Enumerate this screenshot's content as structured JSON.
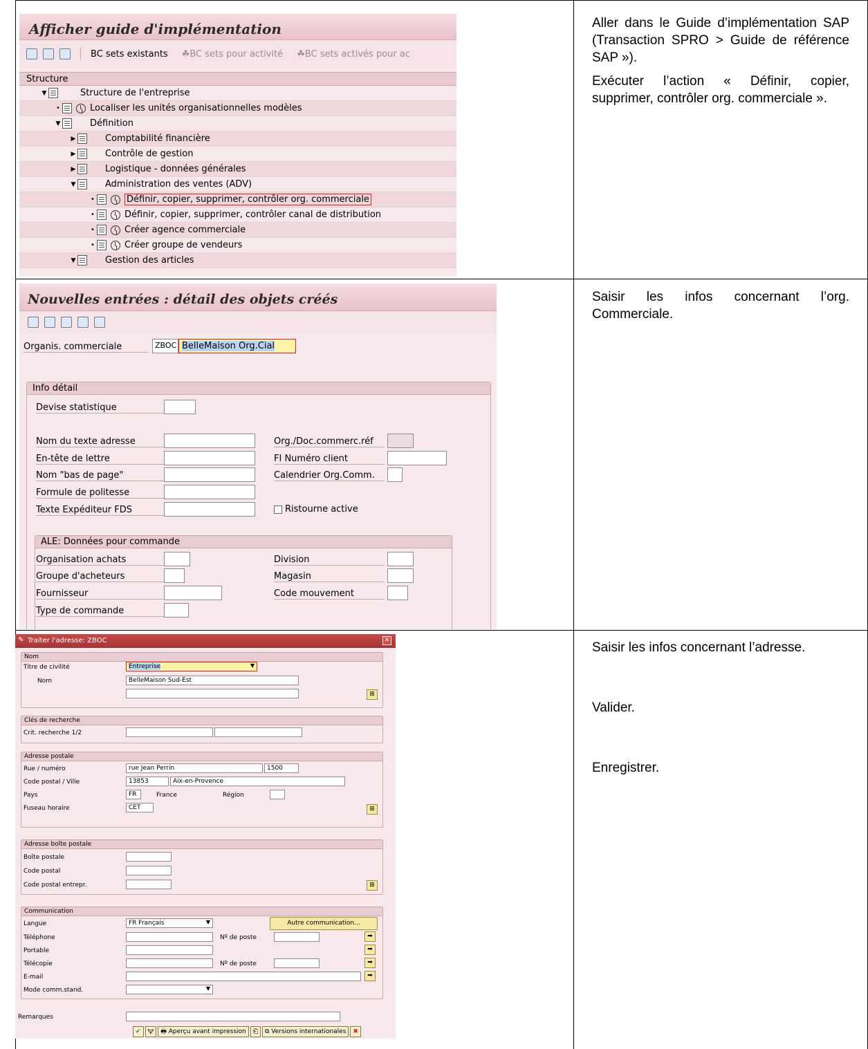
{
  "rows": [
    {
      "instructions": [
        "Aller dans le Guide d’implémentation SAP (Transaction SPRO > Guide de référence SAP »).",
        "Exécuter l’action « Définir, copier, supprimer, contrôler org. commerciale »."
      ]
    },
    {
      "instructions": [
        "Saisir les infos concernant l’org. Commerciale."
      ]
    },
    {
      "instructions": [
        "Saisir les infos concernant l’adresse.",
        "Valider.",
        "Enregistrer."
      ]
    }
  ],
  "shot1": {
    "title": "Afficher guide d'implémentation",
    "toolbar": [
      "BC sets existants",
      "BC sets pour activité",
      "BC sets activés pour ac"
    ],
    "tree_header": "Structure",
    "tree": [
      {
        "label": "Structure de l'entreprise",
        "indent": 0,
        "mark": "▼",
        "clock": false
      },
      {
        "label": "Localiser les unités organisationnelles modèles",
        "indent": 1,
        "mark": "•",
        "clock": true
      },
      {
        "label": "Définition",
        "indent": 1,
        "mark": "▼",
        "clock": false
      },
      {
        "label": "Comptabilité financière",
        "indent": 2,
        "mark": "▶",
        "clock": false
      },
      {
        "label": "Contrôle de gestion",
        "indent": 2,
        "mark": "▶",
        "clock": false
      },
      {
        "label": "Logistique - données générales",
        "indent": 2,
        "mark": "▶",
        "clock": false
      },
      {
        "label": "Administration des ventes (ADV)",
        "indent": 2,
        "mark": "▼",
        "clock": false
      },
      {
        "label": "Définir, copier, supprimer, contrôler org. commerciale",
        "indent": 3,
        "mark": "•",
        "clock": true,
        "selected": true
      },
      {
        "label": "Définir, copier, supprimer, contrôler canal de distribution",
        "indent": 3,
        "mark": "•",
        "clock": true
      },
      {
        "label": "Créer agence commerciale",
        "indent": 3,
        "mark": "•",
        "clock": true
      },
      {
        "label": "Créer groupe de vendeurs",
        "indent": 3,
        "mark": "•",
        "clock": true
      },
      {
        "label": "Gestion des articles",
        "indent": 2,
        "mark": "▼",
        "clock": false
      }
    ]
  },
  "shot2": {
    "title": "Nouvelles entrées : détail des objets créés",
    "org_label": "Organis. commerciale",
    "org_code": "ZBOC",
    "org_name": "BelleMaison Org.Cial",
    "group1": "Info détail",
    "devise": "Devise statistique",
    "left_labels": [
      "Nom du texte adresse",
      "En-tête de lettre",
      "Nom \"bas de page\"",
      "Formule de politesse",
      "Texte Expéditeur FDS"
    ],
    "right_labels": [
      "Org./Doc.commerc.réf",
      "FI Numéro client",
      "Calendrier Org.Comm."
    ],
    "ristourne": "Ristourne active",
    "group2": "ALE: Données pour commande",
    "ale_left": [
      "Organisation achats",
      "Groupe d'acheteurs",
      "Fournisseur",
      "Type de commande"
    ],
    "ale_right": [
      "Division",
      "Magasin",
      "Code mouvement"
    ]
  },
  "shot3": {
    "title": "Traiter l'adresse:  ZBOC",
    "grp_nom": "Nom",
    "titre_label": "Titre de civilité",
    "titre_value": "Entreprise",
    "nom_label": "Nom",
    "nom_value": "BelleMaison Sud-Est",
    "grp_cles": "Clés de recherche",
    "crit_label": "Crit. recherche 1/2",
    "grp_adresse": "Adresse postale",
    "rue_label": "Rue / numéro",
    "rue_value": "rue Jean Perrin",
    "num_value": "1500",
    "cp_label": "Code postal / Ville",
    "cp_value": "13853",
    "ville_value": "Aix-en-Provence",
    "pays_label": "Pays",
    "pays_code": "FR",
    "pays_name": "France",
    "region_label": "Région",
    "fuseau_label": "Fuseau horaire",
    "fuseau_value": "CET",
    "grp_boite": "Adresse boîte postale",
    "boite_labels": [
      "Boîte postale",
      "Code postal",
      "Code postal entrepr."
    ],
    "grp_comm": "Communication",
    "langue_label": "Langue",
    "langue_value": "FR Français",
    "autre_btn": "Autre communication...",
    "tel_label": "Téléphone",
    "poste_label": "Nº de poste",
    "portable_label": "Portable",
    "telecopie_label": "Télécopie",
    "email_label": "E-mail",
    "mode_label": "Mode comm.stand.",
    "remarques_label": "Remarques",
    "btn_apercu": "Aperçu avant impression",
    "btn_versions": "Versions internationales"
  }
}
